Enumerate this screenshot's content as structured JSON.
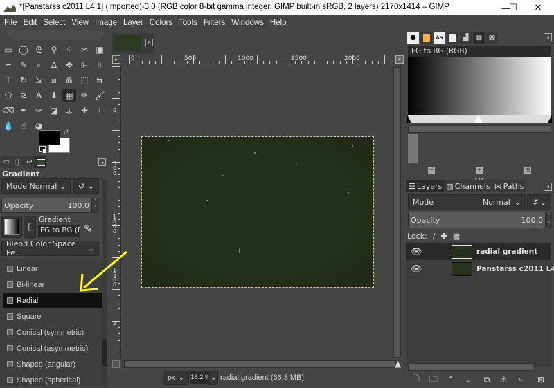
{
  "window": {
    "title": "*[Panstarss c2011 L4 1] (imported)-3.0 (RGB color 8-bit gamma integer, GIMP built-in sRGB, 2 layers) 2170x1414 – GIMP",
    "minimize": "—",
    "maximize": "☐",
    "close": "✕"
  },
  "menu": [
    "File",
    "Edit",
    "Select",
    "View",
    "Image",
    "Layer",
    "Colors",
    "Tools",
    "Filters",
    "Windows",
    "Help"
  ],
  "toolbox": {
    "tools": [
      {
        "name": "rect-select",
        "glyph": "▭"
      },
      {
        "name": "ellipse-select",
        "glyph": "◯"
      },
      {
        "name": "free-select",
        "glyph": "ᘓ"
      },
      {
        "name": "fuzzy-select",
        "glyph": "⚲"
      },
      {
        "name": "by-color-select",
        "glyph": "⁘"
      },
      {
        "name": "scissors-select",
        "glyph": "✂"
      },
      {
        "name": "foreground-select",
        "glyph": "▣"
      },
      {
        "name": "paths",
        "glyph": "⌐"
      },
      {
        "name": "color-picker",
        "glyph": "✎"
      },
      {
        "name": "zoom",
        "glyph": "⌕"
      },
      {
        "name": "measure",
        "glyph": "∆"
      },
      {
        "name": "move",
        "glyph": "✥"
      },
      {
        "name": "align",
        "glyph": "⊫"
      },
      {
        "name": "crop",
        "glyph": "⌗"
      },
      {
        "name": "unified-transform",
        "glyph": "⊤"
      },
      {
        "name": "rotate",
        "glyph": "↻"
      },
      {
        "name": "scale",
        "glyph": "⇲"
      },
      {
        "name": "shear",
        "glyph": "⧄"
      },
      {
        "name": "warp",
        "glyph": "⋒"
      },
      {
        "name": "perspective",
        "glyph": "⬚"
      },
      {
        "name": "flip",
        "glyph": "⇆"
      },
      {
        "name": "cage",
        "glyph": "⬠"
      },
      {
        "name": "wave",
        "glyph": "≋"
      },
      {
        "name": "text",
        "glyph": "A"
      },
      {
        "name": "bucket-fill",
        "glyph": "⬇"
      },
      {
        "name": "gradient",
        "glyph": "▦"
      },
      {
        "name": "pencil",
        "glyph": "✏"
      },
      {
        "name": "paintbrush",
        "glyph": "🖌"
      },
      {
        "name": "eraser",
        "glyph": "⌫"
      },
      {
        "name": "airbrush",
        "glyph": "✒"
      },
      {
        "name": "ink",
        "glyph": "✑"
      },
      {
        "name": "mypaint",
        "glyph": "◪"
      },
      {
        "name": "clone",
        "glyph": "⚶"
      },
      {
        "name": "heal",
        "glyph": "✚"
      },
      {
        "name": "perspective-clone",
        "glyph": "⊥"
      },
      {
        "name": "blur",
        "glyph": "💧"
      },
      {
        "name": "smudge",
        "glyph": "☝"
      },
      {
        "name": "dodge-burn",
        "glyph": "◕"
      }
    ],
    "active_tool": "gradient",
    "fg_color": "#000000",
    "bg_color": "#ffffff"
  },
  "tool_options": {
    "title": "Gradient",
    "mode_label": "Mode",
    "mode_value": "Normal",
    "opacity_label": "Opacity",
    "opacity_value": "100.0",
    "gradient_label": "Gradient",
    "gradient_value": "FG to BG (R",
    "blend_space": "Blend Color Space Pe...",
    "shapes": [
      "Linear",
      "Bi-linear",
      "Radial",
      "Square",
      "Conical (symmetric)",
      "Conical (asymmetric)",
      "Shaped (angular)",
      "Shaped (spherical)"
    ],
    "selected_shape": "Radial"
  },
  "canvas": {
    "ruler_h_labels": [
      "0",
      "500",
      "1000",
      "1500",
      "2000"
    ],
    "ruler_v_labels": [
      "0",
      "500",
      "1000",
      "1500",
      "2"
    ],
    "image_bg": "#25301b",
    "selection_color": "#e0e000"
  },
  "status": {
    "unit": "px",
    "zoom": "18.2 %",
    "info": "radial gradient (66,3 MB)"
  },
  "gradients_panel": {
    "name": "FG to BG (RGB)"
  },
  "layers_panel": {
    "tabs": [
      "Layers",
      "Channels",
      "Paths"
    ],
    "mode_label": "Mode",
    "mode_value": "Normal",
    "opacity_label": "Opacity",
    "opacity_value": "100.0",
    "lock_label": "Lock:",
    "layers": [
      {
        "name": "radial gradient",
        "selected": true
      },
      {
        "name": "Panstarss c2011 L4",
        "selected": false
      }
    ]
  },
  "annotation": {
    "arrow_color": "#ffff00"
  }
}
